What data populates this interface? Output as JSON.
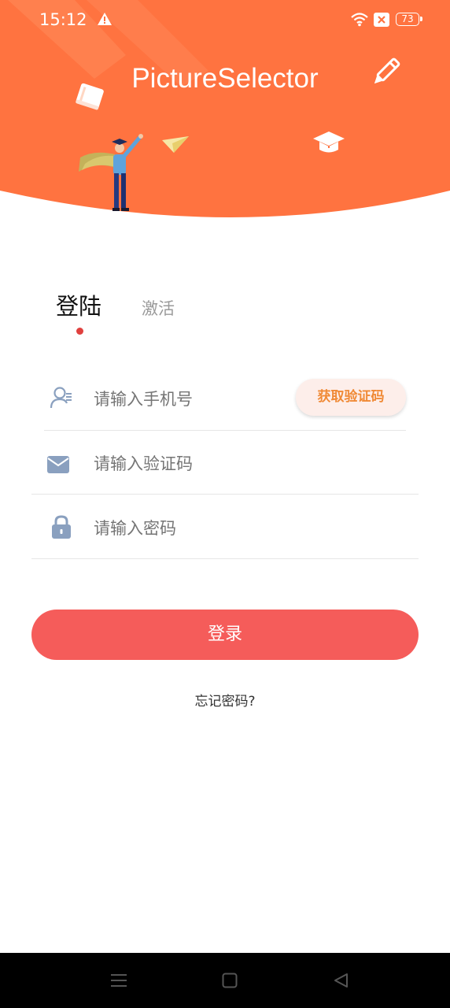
{
  "status_bar": {
    "time": "15:12",
    "battery": "73"
  },
  "header": {
    "title": "PictureSelector",
    "background_color": "#ff7340"
  },
  "tabs": {
    "login": "登陆",
    "activate": "激活"
  },
  "form": {
    "phone_placeholder": "请输入手机号",
    "get_code_label": "获取验证码",
    "code_placeholder": "请输入验证码",
    "password_placeholder": "请输入密码"
  },
  "login_button": "登录",
  "forgot_password": "忘记密码?",
  "colors": {
    "accent": "#f55c5a",
    "tab_dot": "#e0403e",
    "icon": "#8aa0bf"
  },
  "nav_icons": [
    "menu-icon",
    "home-icon",
    "back-icon"
  ]
}
